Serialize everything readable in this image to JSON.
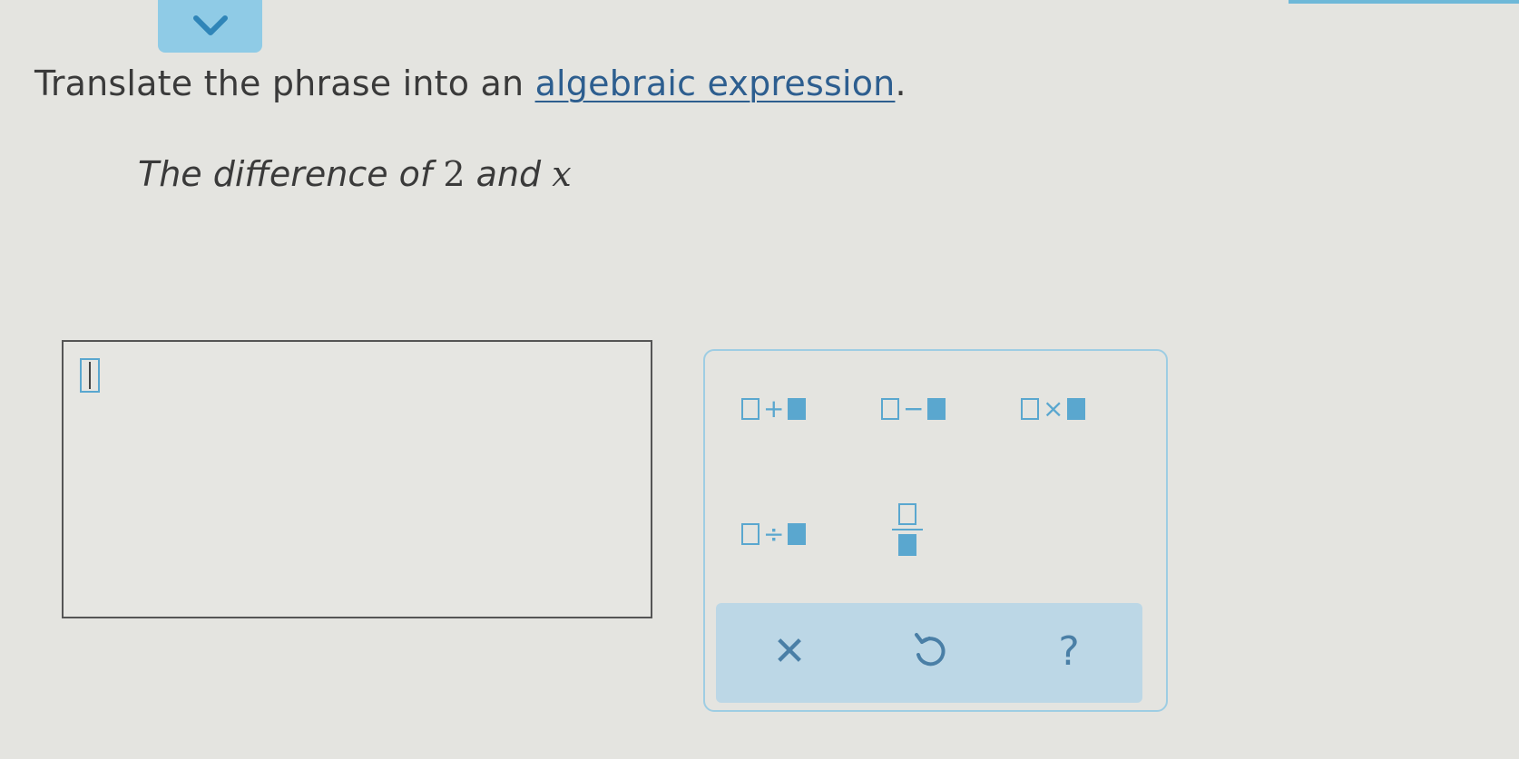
{
  "header": {
    "collapse_icon": "chevron-down-icon"
  },
  "question": {
    "instruction_prefix": "Translate the phrase into an ",
    "instruction_link": "algebraic expression",
    "instruction_suffix": ".",
    "phrase_prefix": "The difference of ",
    "phrase_number": "2",
    "phrase_middle": " and ",
    "phrase_variable": "x"
  },
  "answer": {
    "value": ""
  },
  "palette": {
    "add_symbol": "+",
    "subtract_symbol": "−",
    "multiply_symbol": "×",
    "divide_symbol": "÷",
    "clear_symbol": "✕",
    "help_symbol": "?"
  },
  "colors": {
    "accent": "#5aa7cf",
    "link": "#2d5e8f",
    "action_bar": "#bcd7e6"
  }
}
